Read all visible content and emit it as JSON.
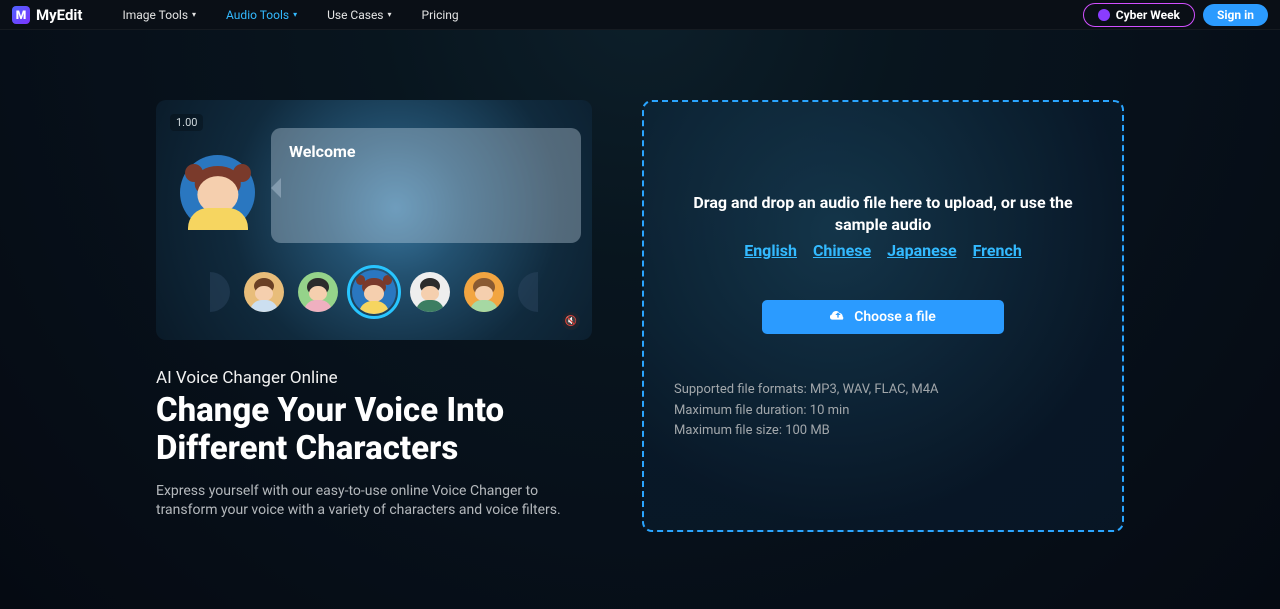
{
  "nav": {
    "brand": "MyEdit",
    "items": [
      {
        "label": "Image Tools",
        "caret": true
      },
      {
        "label": "Audio Tools",
        "caret": true,
        "accent": true
      },
      {
        "label": "Use Cases",
        "caret": true
      },
      {
        "label": "Pricing",
        "caret": false
      }
    ],
    "cyber_label": "Cyber Week",
    "signin_label": "Sign in"
  },
  "preview": {
    "timer": "1.00",
    "speech": "Welcome",
    "avatars": [
      {
        "bg": "#2c4660",
        "hair": "",
        "shirt": ""
      },
      {
        "bg": "#e8bd7a",
        "hair": "#6a4025",
        "shirt": "#ccdff0"
      },
      {
        "bg": "#95d38a",
        "hair": "#2c2c2c",
        "shirt": "#efb0c0"
      },
      {
        "bg": "#2a77c0",
        "hair": "#7a3a2b",
        "shirt": "#f6d560",
        "selected": true
      },
      {
        "bg": "#eeeeee",
        "hair": "#2c2c2c",
        "shirt": "#3c7e62"
      },
      {
        "bg": "#f2a541",
        "hair": "#8a5a32",
        "shirt": "#a6d8a3"
      },
      {
        "bg": "#2c4660",
        "hair": "",
        "shirt": ""
      }
    ]
  },
  "hero": {
    "subtitle": "AI Voice Changer Online",
    "headline": "Change Your Voice Into Different Characters",
    "desc": "Express yourself with our easy-to-use online Voice Changer to transform your voice with a variety of characters and voice filters."
  },
  "dropzone": {
    "text_line1": "Drag and drop an audio file here to upload, or  use the",
    "text_line2": "sample audio",
    "languages": [
      "English",
      "Chinese",
      "Japanese",
      "French"
    ],
    "choose_label": "Choose a file",
    "limits": {
      "formats": "Supported file formats: MP3, WAV, FLAC, M4A",
      "duration": "Maximum file duration: 10 min",
      "size": "Maximum file size: 100 MB"
    }
  }
}
